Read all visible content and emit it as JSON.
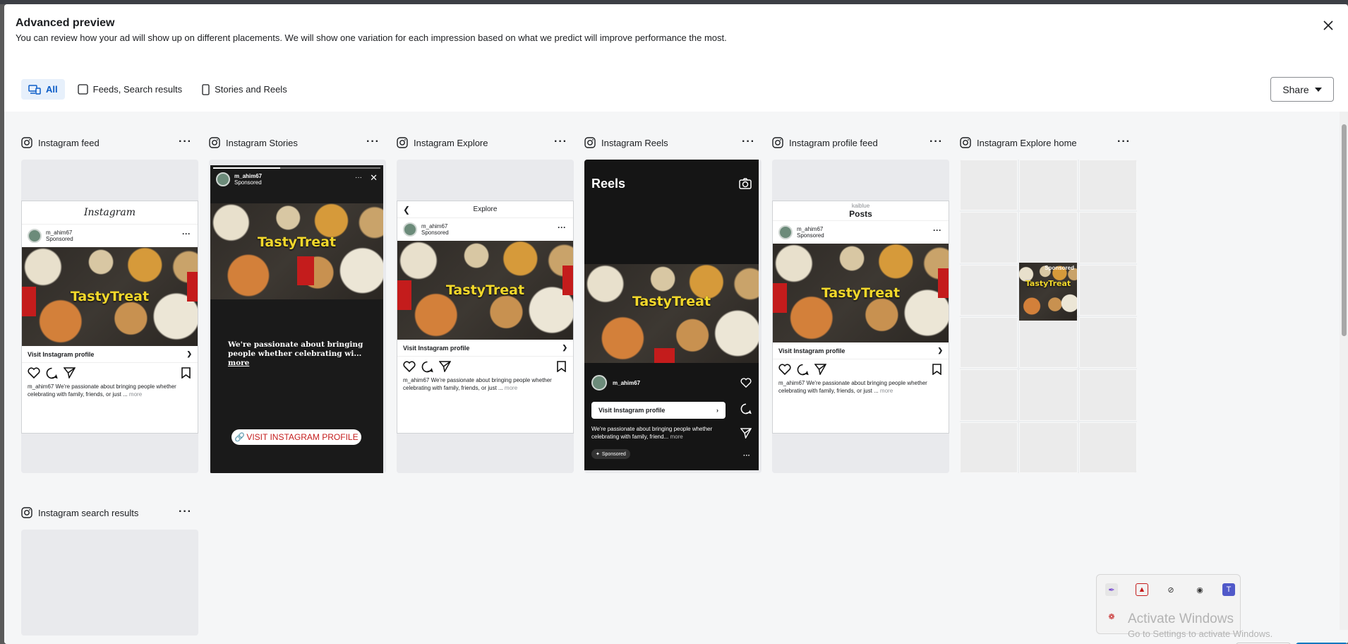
{
  "dialog": {
    "title": "Advanced preview",
    "subtitle": "You can review how your ad will show up on different placements. We will show one variation for each impression based on what we predict will improve performance the most."
  },
  "filters": [
    {
      "label": "All",
      "active": true
    },
    {
      "label": "Feeds, Search results",
      "active": false
    },
    {
      "label": "Stories and Reels",
      "active": false
    }
  ],
  "share_label": "Share",
  "placements": {
    "feed": "Instagram feed",
    "stories": "Instagram Stories",
    "explore": "Instagram Explore",
    "reels": "Instagram Reels",
    "profile": "Instagram profile feed",
    "explore_home": "Instagram Explore home",
    "search": "Instagram search results"
  },
  "ad": {
    "brand": "TastyTreat",
    "username": "m_ahim67",
    "sponsored": "Sponsored",
    "cta": "Visit Instagram profile",
    "caption": "m_ahim67 We're passionate about bringing people whether celebrating with family, friends, or just ...",
    "caption_more": "more",
    "more_label": "more",
    "feed_app_title": "Instagram",
    "explore_title": "Explore",
    "profile_user": "kaiblue",
    "profile_title": "Posts",
    "story_text": "We're passionate about bringing people whether celebrating wi...",
    "story_cta": "VISIT INSTAGRAM PROFILE",
    "reels_title": "Reels",
    "reels_caption": "We're passionate about bringing people whether celebrating with family, friend...",
    "reels_sponsored": "Sponsored"
  },
  "system": {
    "watermark_line1": "Activate Windows",
    "watermark_line2": "Go to Settings to activate Windows."
  },
  "colors": {
    "accent": "#0a5cc7",
    "brand_yellow": "#f2d82b",
    "ig_red": "#c41c1c"
  }
}
